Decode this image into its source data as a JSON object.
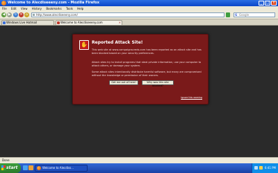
{
  "window": {
    "title": "Welcome to Alecdiseeeny.com - Mozilla Firefox",
    "min_label": "_",
    "max_label": "□",
    "close_label": "x"
  },
  "menu": [
    "File",
    "Edit",
    "View",
    "History",
    "Bookmarks",
    "Tools",
    "Help"
  ],
  "nav": {
    "url": "http://www.alecdiseeeny.com/",
    "search_placeholder": "Google"
  },
  "tabs": [
    {
      "label": "Windows Live Hotmail",
      "active": false
    },
    {
      "label": "Welcome to Alecdiseeeny.com",
      "active": true
    }
  ],
  "warning": {
    "title": "Reported Attack Site!",
    "para1": "This web site at www.campaignscreds.com has been reported as an attack site and has been blocked based on your security preferences.",
    "para2": "Attack sites try to install programs that steal private information, use your computer to attack others, or damage your system.",
    "para3": "Some attack sites intentionally distribute harmful software, but many are compromised without the knowledge or permission of their owners.",
    "btn_get_out": "Get me out of here!",
    "btn_why": "Why was this site blocked?",
    "ignore_link": "Ignore this warning"
  },
  "status": {
    "text": "Done"
  },
  "taskbar": {
    "start_label": "start",
    "task_label": "Welcome to Alecdiss...",
    "clock": "6:41 PM"
  },
  "colors": {
    "warning_bg": "#7a1a1a",
    "content_bg": "#2a2a2a",
    "taskbar": "#245edb"
  }
}
